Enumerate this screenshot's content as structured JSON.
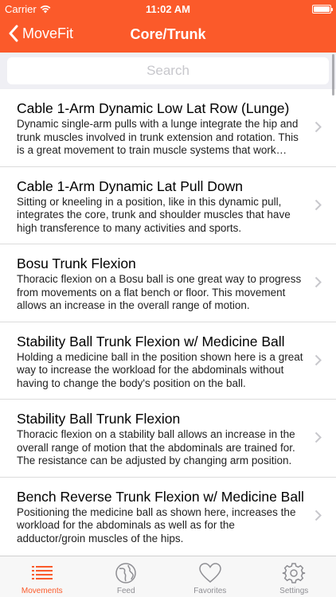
{
  "status_bar": {
    "carrier": "Carrier",
    "time": "11:02 AM"
  },
  "nav": {
    "back_label": "MoveFit",
    "title": "Core/Trunk"
  },
  "search": {
    "placeholder": "Search"
  },
  "items": [
    {
      "title": "Cable 1-Arm Dynamic Low Lat Row (Lunge)",
      "description": "Dynamic single-arm pulls with a lunge integrate the hip and trunk muscles involved in trunk extension and rotation. This is a great movement to train muscle systems that work together."
    },
    {
      "title": "Cable 1-Arm Dynamic Lat Pull Down",
      "description": "Sitting or kneeling in a position, like in this dynamic pull, integrates the core, trunk and shoulder muscles that have high transference to many activities and sports."
    },
    {
      "title": "Bosu Trunk Flexion",
      "description": "Thoracic flexion on a Bosu ball is one great way to progress from movements on a flat bench or floor. This movement allows an increase in the overall range of motion."
    },
    {
      "title": "Stability Ball Trunk Flexion w/ Medicine Ball",
      "description": "Holding a medicine ball in the position shown here is a great way to increase the workload for the abdominals without having to change the body's position on the ball."
    },
    {
      "title": "Stability Ball Trunk Flexion",
      "description": "Thoracic flexion on a stability ball allows an increase in the overall range of motion that the abdominals are trained for. The resistance can be adjusted by changing arm position."
    },
    {
      "title": "Bench Reverse Trunk Flexion w/ Medicine Ball",
      "description": "Positioning the medicine ball as shown here, increases the workload for the abdominals as well as for the adductor/groin muscles of the hips."
    }
  ],
  "tabs": [
    {
      "label": "Movements",
      "icon": "list-icon",
      "active": true
    },
    {
      "label": "Feed",
      "icon": "globe-icon",
      "active": false
    },
    {
      "label": "Favorites",
      "icon": "heart-icon",
      "active": false
    },
    {
      "label": "Settings",
      "icon": "gear-icon",
      "active": false
    }
  ],
  "colors": {
    "accent": "#fb5a2a",
    "inactive": "#8e8e93"
  }
}
